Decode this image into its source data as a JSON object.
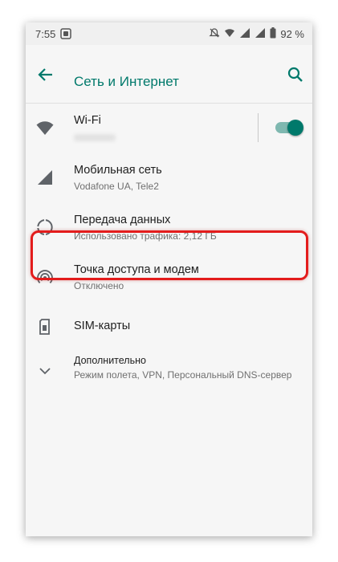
{
  "status_bar": {
    "time": "7:55",
    "battery": "92 %"
  },
  "header": {
    "title": "Сеть и Интернет"
  },
  "items": [
    {
      "title": "Wi-Fi",
      "subtitle": "",
      "icon": "wifi-icon",
      "toggle_on": true
    },
    {
      "title": "Мобильная сеть",
      "subtitle": "Vodafone UA, Tele2",
      "icon": "cellular-signal-icon"
    },
    {
      "title": "Передача данных",
      "subtitle": "Использовано трафика: 2,12 ГБ",
      "icon": "data-usage-icon"
    },
    {
      "title": "Точка доступа и модем",
      "subtitle": "Отключено",
      "icon": "hotspot-icon"
    },
    {
      "title": "SIM-карты",
      "subtitle": "",
      "icon": "sim-card-icon"
    },
    {
      "title": "Дополнительно",
      "subtitle": "Режим полета, VPN, Персональный DNS-сервер",
      "icon": "chevron-down-icon"
    }
  ],
  "colors": {
    "accent": "#00796b",
    "highlight": "#e31c1c",
    "toggle_track": "#7fb8b0"
  }
}
